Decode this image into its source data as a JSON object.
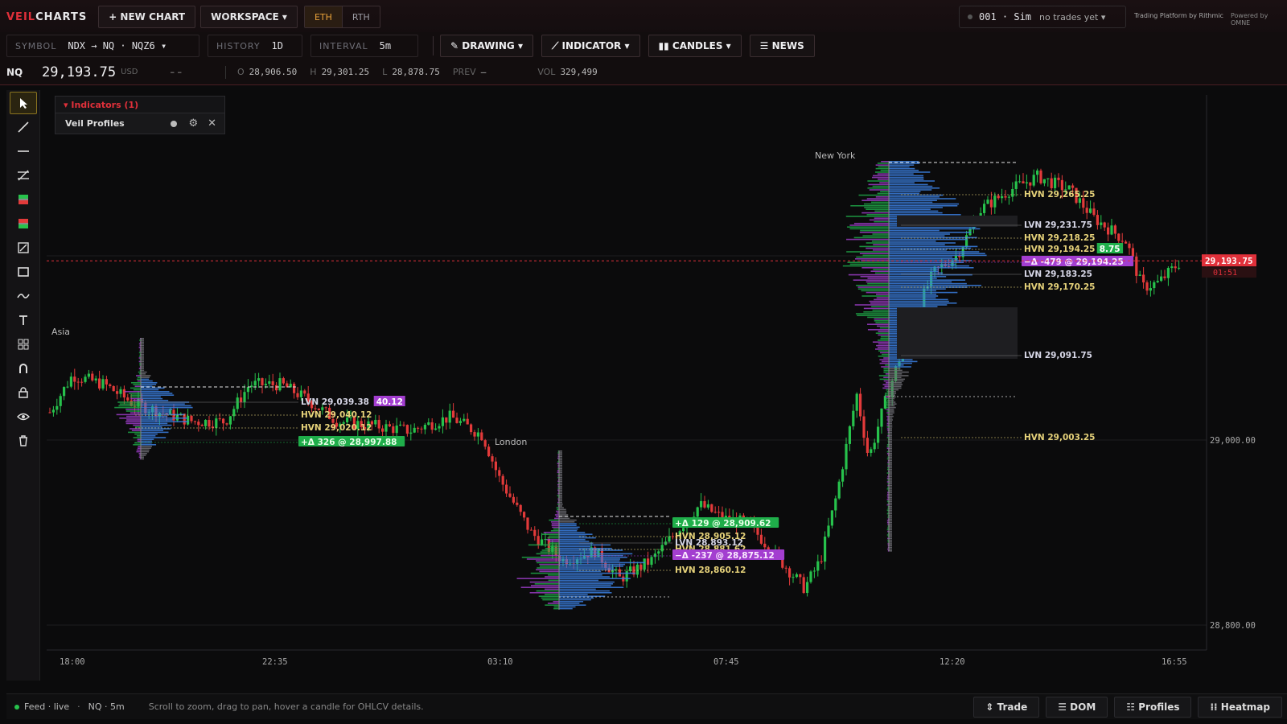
{
  "app": {
    "logo_a": "VEIL",
    "logo_b": "CHARTS",
    "new_chart": "+ NEW CHART",
    "workspace": "WORKSPACE ▾",
    "session_eth": "ETH",
    "session_rth": "RTH",
    "account": "001 · Sim",
    "account_status": "no trades yet ▾",
    "brand1": "Trading Platform by Rithmic",
    "brand2": "Powered by OMNE"
  },
  "toolbar": {
    "symbol_label": "SYMBOL",
    "symbol_value": "NDX → NQ · NQZ6 ▾",
    "history_label": "HISTORY",
    "history_value": "1D",
    "interval_label": "INTERVAL",
    "interval_value": "5m",
    "drawing": "✎ DRAWING ▾",
    "indicator": "⟋ INDICATOR ▾",
    "candles": "▮▮ CANDLES ▾",
    "news": "☰ NEWS"
  },
  "quote": {
    "symbol": "NQ",
    "price": "29,193.75",
    "currency": "USD",
    "change": "– –",
    "o_k": "O",
    "o_v": "28,906.50",
    "h_k": "H",
    "h_v": "29,301.25",
    "l_k": "L",
    "l_v": "28,878.75",
    "prev_k": "PREV",
    "prev_v": "–",
    "vol_k": "VOL",
    "vol_v": "329,499"
  },
  "indicators": {
    "header": "▾ Indicators (1)",
    "item": "Veil Profiles"
  },
  "chart_data": {
    "type": "candlestick",
    "symbol": "NQ",
    "interval": "5m",
    "x_ticks": [
      "18:00",
      "22:35",
      "03:10",
      "07:45",
      "12:20",
      "16:55"
    ],
    "y_ticks": [
      "29,000.00",
      "28,800.00"
    ],
    "ylim": [
      28780,
      29335
    ],
    "last_price": {
      "value": "29,193.75",
      "numeric": 29193.75,
      "countdown": "01:51"
    },
    "sessions": [
      {
        "name": "Asia",
        "levels": [
          {
            "label": "LVN 29,039.38",
            "price": 29039.38,
            "kind": "LVN",
            "tag": "40.12"
          },
          {
            "label": "HVN 29,040.12",
            "price": 29040.12,
            "kind": "HVN"
          },
          {
            "label": "HVN 29,020.12",
            "price": 29020.12,
            "kind": "HVN"
          },
          {
            "label": "+Δ 326 @ 28,997.88",
            "price": 28997.88,
            "kind": "DPOS"
          }
        ]
      },
      {
        "name": "London",
        "levels": [
          {
            "label": "+Δ 129 @ 28,909.62",
            "price": 28909.62,
            "kind": "DPOS"
          },
          {
            "label": "HVN 28,905.12",
            "price": 28905.12,
            "kind": "HVN"
          },
          {
            "label": "LVN 28,893.12",
            "price": 28893.12,
            "kind": "LVN"
          },
          {
            "label": "HVN 28,881.62",
            "price": 28881.62,
            "kind": "HVN"
          },
          {
            "label": "−Δ -237 @ 28,875.12",
            "price": 28875.12,
            "kind": "DNEG"
          },
          {
            "label": "HVN 28,860.12",
            "price": 28860.12,
            "kind": "HVN"
          }
        ]
      },
      {
        "name": "New York",
        "levels": [
          {
            "label": "HVN 29,265.25",
            "price": 29265.25,
            "kind": "HVN"
          },
          {
            "label": "LVN 29,231.75",
            "price": 29231.75,
            "kind": "LVN"
          },
          {
            "label": "HVN 29,218.25",
            "price": 29218.25,
            "kind": "HVN"
          },
          {
            "label": "HVN 29,194.25",
            "price": 29194.25,
            "kind": "HVN",
            "tag": "8.75"
          },
          {
            "label": "−Δ -479 @ 29,194.25",
            "price": 29194.25,
            "kind": "DNEG"
          },
          {
            "label": "LVN 29,183.25",
            "price": 29183.25,
            "kind": "LVN"
          },
          {
            "label": "HVN 29,170.25",
            "price": 29170.25,
            "kind": "HVN"
          },
          {
            "label": "LVN 29,091.75",
            "price": 29091.75,
            "kind": "LVN"
          },
          {
            "label": "HVN 29,003.25",
            "price": 29003.25,
            "kind": "HVN"
          }
        ]
      }
    ]
  },
  "status": {
    "feed": "Feed · live",
    "sep": "·",
    "instrument": "NQ · 5m",
    "hint": "Scroll to zoom, drag to pan, hover a candle for OHLCV details.",
    "trade": "⇕ Trade",
    "dom": "☰ DOM",
    "profiles": "☷ Profiles",
    "heatmap": "⁞⁞ Heatmap"
  },
  "colors": {
    "accent": "#e0303a",
    "up": "#27c24c",
    "down": "#e23a3a",
    "profile": "#3b7fe0",
    "hvn": "#e6d27a",
    "lvn": "#d6d6e6",
    "delta_pos": "#1fae4a",
    "delta_neg": "#a33ed0"
  }
}
